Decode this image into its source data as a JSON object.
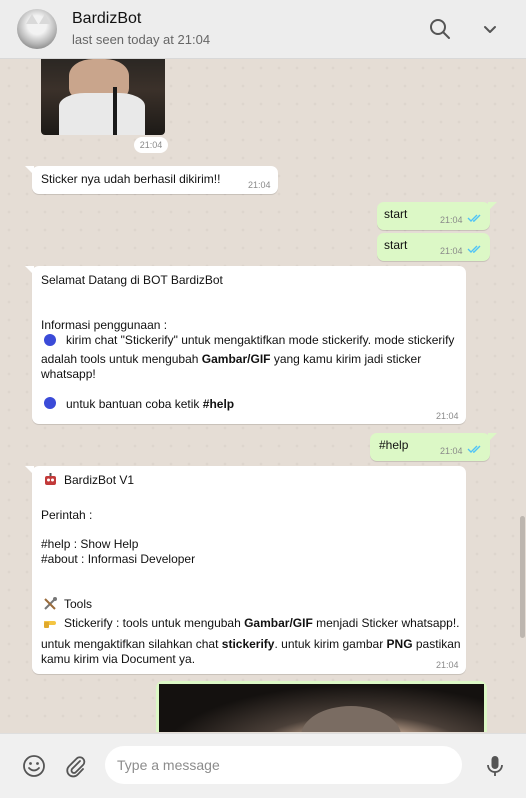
{
  "header": {
    "contact_name": "BardizBot",
    "status": "last seen today at 21:04",
    "avatar_icon": "cat-avatar",
    "search_icon": "search-icon",
    "menu_icon": "chevron-down-icon"
  },
  "messages": {
    "img1_time": "21:04",
    "m1": {
      "text": "Sticker nya udah berhasil dikirim!!",
      "time": "21:04"
    },
    "m2": {
      "text": "start",
      "time": "21:04"
    },
    "m3": {
      "text": "start",
      "time": "21:04"
    },
    "m4": {
      "line1": "Selamat Datang di BOT BardizBot",
      "line2": "Informasi penggunaan :",
      "line3": "kirim chat \"Stickerify\" untuk mengaktifkan mode stickerify. mode stickerify",
      "line4_pre": "adalah tools untuk mengubah ",
      "line4_bold": "Gambar/GIF",
      "line4_post": " yang kamu kirim jadi sticker",
      "line5": "whatsapp!",
      "line6_pre": "untuk bantuan coba ketik ",
      "line6_bold": "#help",
      "time": "21:04"
    },
    "m5": {
      "text": "#help",
      "time": "21:04"
    },
    "m6": {
      "line1": "BardizBot V1",
      "line2": "Perintah :",
      "line3": "#help : Show Help",
      "line4": "#about : Informasi Developer",
      "line5": "Tools",
      "line6_pre": "Stickerify : tools untuk mengubah ",
      "line6_bold": "Gambar/GIF",
      "line6_post": " menjadi Sticker whatsapp!.",
      "line7_pre": "untuk mengaktifkan silahkan chat ",
      "line7_bold": "stickerify",
      "line7_mid": ". untuk kirim gambar ",
      "line7_bold2": "PNG",
      "line7_post": " pastikan",
      "line8": "kamu kirim via Document ya.",
      "time": "21:04"
    }
  },
  "footer": {
    "placeholder": "Type a message",
    "emoji_icon": "emoji-icon",
    "attach_icon": "paperclip-icon",
    "mic_icon": "microphone-icon"
  },
  "colors": {
    "chat_bg": "#e5ddd5",
    "incoming": "#ffffff",
    "outgoing": "#dcf8c6",
    "read_ticks": "#4fc3f7",
    "header_bg": "#ededed"
  }
}
